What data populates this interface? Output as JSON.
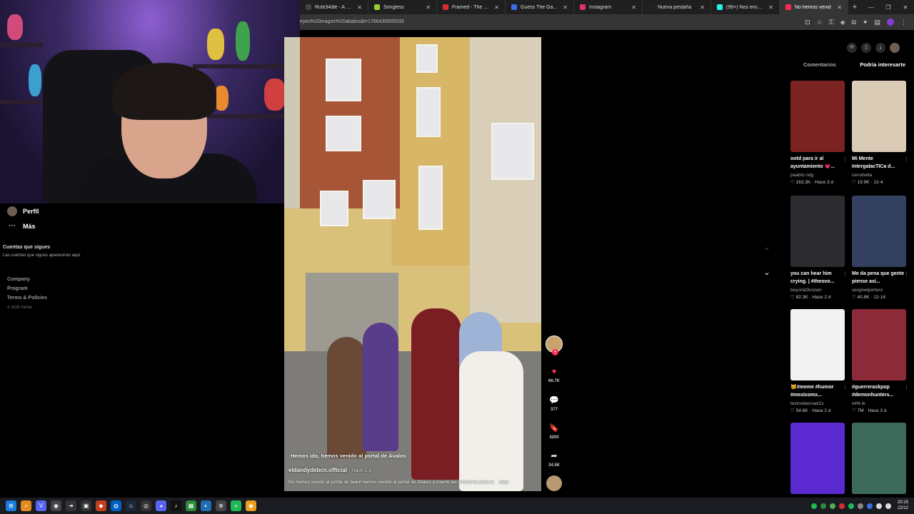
{
  "browser": {
    "tabs": [
      {
        "label": "Rule34dle - A Higher o",
        "color": "#444"
      },
      {
        "label": "Songless",
        "color": "#9acd32"
      },
      {
        "label": "Framed - The daily m",
        "color": "#d92c2c"
      },
      {
        "label": "Guess The Game #131",
        "color": "#3a6ee8"
      },
      {
        "label": "Instagram",
        "color": "#e1306c"
      },
      {
        "label": "Nueva pestaña",
        "color": "#222"
      },
      {
        "label": "(99+) Nos encontr",
        "color": "#25f4ee"
      },
      {
        "label": "No hemos venid",
        "color": "#fe2c55"
      }
    ],
    "url_fragment": "eyes%20magos%20abalos&t=1766430655533"
  },
  "leftnav": {
    "profile_label": "Perfil",
    "more_label": "Más",
    "following_title": "Cuentas que sigues",
    "following_desc": "Las cuentas que sigues aparecerán aquí",
    "footer": [
      "Company",
      "Program",
      "Terms & Policies"
    ],
    "copyright": "© 2025 TikTok"
  },
  "video": {
    "caption": "Hemos ido, hemos venido al portal de Ávalos",
    "author": "eldandydebcn.official",
    "age": "· Hace 1 d",
    "description": "No hemos venido al portal de belen hemos venido al portal de Abalos a traerle las chistorras para la",
    "more_label": "más"
  },
  "actions": {
    "likes": "66.7K",
    "comments": "377",
    "saves": "4200",
    "shares": "34.5K"
  },
  "rightpanel": {
    "tab_comments": "Comentarios",
    "tab_related": "Podría interesarte",
    "cards": [
      {
        "title": "ootd para ir al ayuntamiento 💗...",
        "author": "paablo.ndg",
        "likes": "163.3K",
        "date": "Hace 3 d",
        "bg": "#7a2320"
      },
      {
        "title": "Mi Mente IntergalacTICa d...",
        "author": "cenobelta",
        "likes": "19.9K",
        "date": "12-4",
        "bg": "#d9cbb6"
      },
      {
        "title": "you can hear him crying. | #theovo...",
        "author": "beyond2known",
        "likes": "82.3K",
        "date": "Hace 2 d",
        "bg": "#2c2c30"
      },
      {
        "title": "Me da pena que gente piense así...",
        "author": "sergioelportero",
        "likes": "40.8K",
        "date": "12-14",
        "bg": "#334060"
      },
      {
        "title": "🐱#meme #humor #mexicomx...",
        "author": "textosbiensak2s",
        "likes": "54.6K",
        "date": "Hace 2 d",
        "bg": "#f2f2f2"
      },
      {
        "title": "#guerreraskpop #demonhunters...",
        "author": "wtf4.le",
        "likes": "7M",
        "date": "Hace 3 d",
        "bg": "#8c2a3a"
      },
      {
        "title": "",
        "author": "",
        "likes": "",
        "date": "",
        "bg": "#5a2ad0"
      },
      {
        "title": "",
        "author": "",
        "likes": "",
        "date": "",
        "bg": "#3c6a5a"
      }
    ]
  },
  "taskbar": {
    "time": "20:15",
    "date": "22/12"
  }
}
